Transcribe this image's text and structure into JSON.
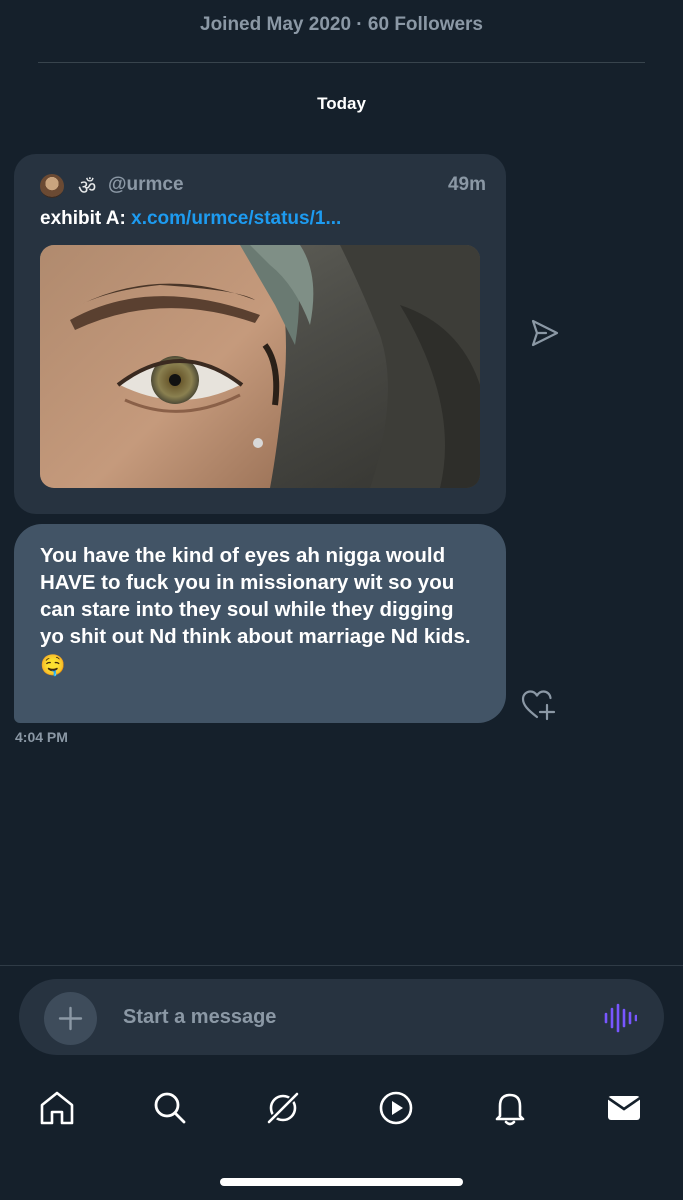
{
  "profile": {
    "joined_info": "Joined May 2020 · 60 Followers"
  },
  "conversation": {
    "date_separator": "Today"
  },
  "shared_post": {
    "author_symbol": "ॐ",
    "author_handle": "@urmce",
    "time": "49m",
    "text_lead": "exhibit A: ",
    "link_text": "x.com/urmce/status/1..."
  },
  "message": {
    "text": "You have the kind of eyes ah nigga would HAVE to fuck you in missionary wit so you can stare into they soul while they digging yo shit out Nd think about marriage Nd kids.",
    "emoji": "🤤",
    "timestamp": "4:04 PM"
  },
  "composer": {
    "placeholder": "Start a message"
  },
  "colors": {
    "background": "#15202b",
    "bubble": "#425466",
    "card": "#273340",
    "link": "#1d9bf0",
    "voice_accent": "#7856ff"
  },
  "nav": {
    "items": [
      "home-icon",
      "search-icon",
      "grok-icon",
      "video-icon",
      "notifications-icon",
      "messages-icon"
    ],
    "active": "messages-icon"
  }
}
